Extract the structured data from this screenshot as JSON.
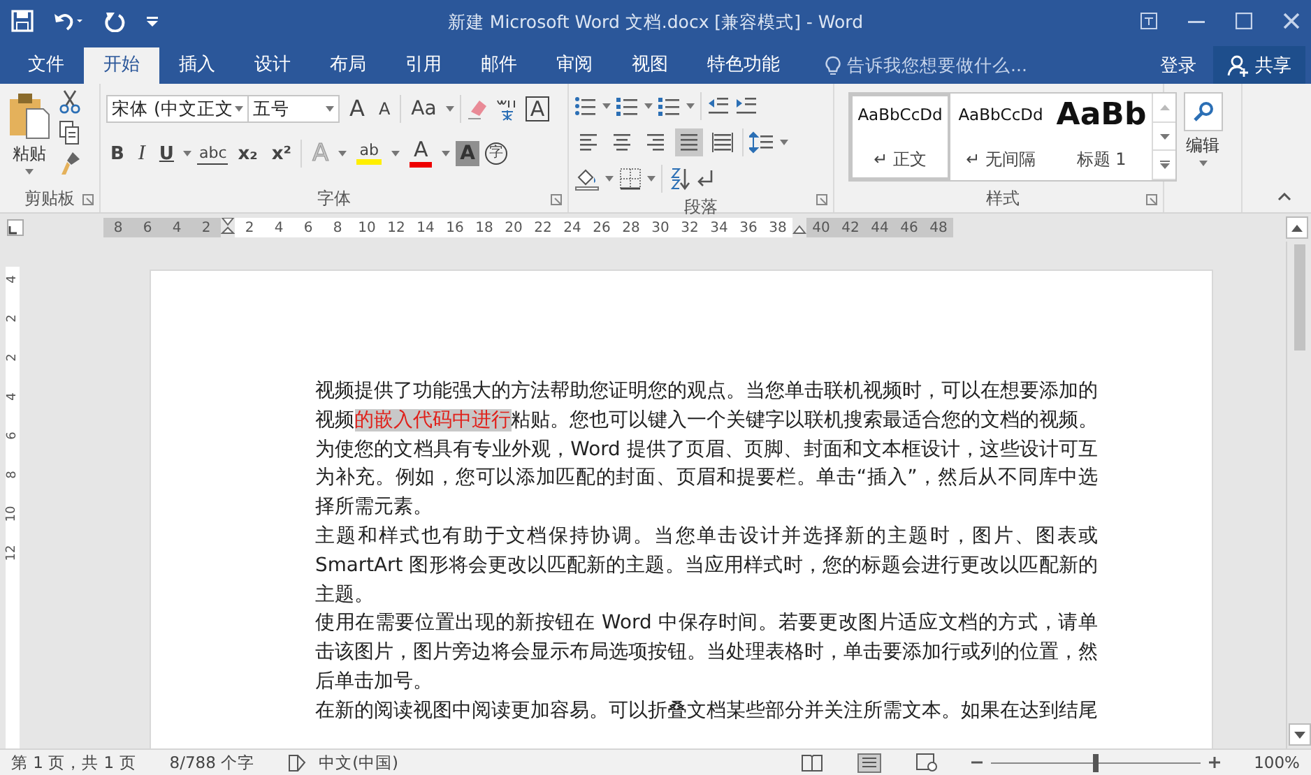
{
  "window": {
    "title": "新建 Microsoft Word 文档.docx [兼容模式] - Word"
  },
  "tabs": [
    {
      "label": "文件",
      "selected": false
    },
    {
      "label": "开始",
      "selected": true
    },
    {
      "label": "插入",
      "selected": false
    },
    {
      "label": "设计",
      "selected": false
    },
    {
      "label": "布局",
      "selected": false
    },
    {
      "label": "引用",
      "selected": false
    },
    {
      "label": "邮件",
      "selected": false
    },
    {
      "label": "审阅",
      "selected": false
    },
    {
      "label": "视图",
      "selected": false
    },
    {
      "label": "特色功能",
      "selected": false
    }
  ],
  "tell_me": {
    "placeholder": "告诉我您想要做什么..."
  },
  "account": {
    "sign_in": "登录",
    "share": "共享"
  },
  "ribbon": {
    "clipboard": {
      "paste": "粘贴",
      "label": "剪贴板"
    },
    "font": {
      "font_name": "宋体 (中文正文",
      "font_size": "五号",
      "label": "字体",
      "row1": [
        {
          "kind": "grow",
          "text": "A"
        },
        {
          "kind": "shrink",
          "text": "A"
        },
        {
          "kind": "case",
          "text": "Aa"
        },
        {
          "kind": "border",
          "text": "A"
        }
      ],
      "row2": [
        {
          "kind": "bold",
          "text": "B"
        },
        {
          "kind": "italic",
          "text": "I"
        },
        {
          "kind": "underline",
          "text": "U"
        },
        {
          "kind": "strike",
          "text": "abc"
        },
        {
          "kind": "sub",
          "text": "x₂"
        },
        {
          "kind": "sup",
          "text": "x²"
        },
        {
          "kind": "effects",
          "text": "A"
        },
        {
          "kind": "highlight",
          "text": "ab"
        },
        {
          "kind": "color",
          "text": "A"
        },
        {
          "kind": "shading",
          "text": "A"
        },
        {
          "kind": "enclose",
          "text": "字"
        }
      ]
    },
    "paragraph": {
      "label": "段落",
      "alignments": [
        {
          "kind": "left",
          "selected": false
        },
        {
          "kind": "center",
          "selected": false
        },
        {
          "kind": "right",
          "selected": false
        },
        {
          "kind": "justify",
          "selected": true
        },
        {
          "kind": "distributed",
          "selected": false
        }
      ]
    },
    "styles": {
      "label": "样式",
      "items": [
        {
          "kind": "normal",
          "preview": "AaBbCcDd",
          "name": "↵ 正文",
          "selected": true
        },
        {
          "kind": "normal",
          "preview": "AaBbCcDd",
          "name": "↵ 无间隔",
          "selected": false
        },
        {
          "kind": "heading",
          "preview": "AaBb",
          "name": "标题 1",
          "selected": false
        }
      ]
    },
    "editing": {
      "label": "编辑"
    }
  },
  "ruler": {
    "left_ticks": [
      "8",
      "6",
      "4",
      "2"
    ],
    "body_ticks": [
      "2",
      "4",
      "6",
      "8",
      "10",
      "12",
      "14",
      "16",
      "18",
      "20",
      "22",
      "24",
      "26",
      "28",
      "30",
      "32",
      "34",
      "36",
      "38"
    ],
    "right_ticks": [
      "40",
      "42",
      "44",
      "46",
      "48"
    ],
    "vertical_ticks": [
      "4",
      "2",
      "2",
      "4",
      "6",
      "8",
      "10",
      "12"
    ]
  },
  "document": {
    "paragraphs": [
      {
        "runs": [
          {
            "text": "视频提供了功能强大的方法帮助您证明您的观点。当您单击联机视频时，可以在想要添加的视频",
            "highlighted": false
          },
          {
            "text": "的嵌入代码中进行",
            "highlighted": true
          },
          {
            "text": "粘贴。您也可以键入一个关键字以联机搜索最适合您的文档的视频。",
            "highlighted": false
          }
        ]
      },
      {
        "runs": [
          {
            "text": "为使您的文档具有专业外观，Word 提供了页眉、页脚、封面和文本框设计，这些设计可互为补充。例如，您可以添加匹配的封面、页眉和提要栏。单击“插入”，然后从不同库中选择所需元素。",
            "highlighted": false
          }
        ]
      },
      {
        "runs": [
          {
            "text": "主题和样式也有助于文档保持协调。当您单击设计并选择新的主题时，图片、图表或 SmartArt 图形将会更改以匹配新的主题。当应用样式时，您的标题会进行更改以匹配新的主题。",
            "highlighted": false
          }
        ]
      },
      {
        "runs": [
          {
            "text": "使用在需要位置出现的新按钮在 Word 中保存时间。若要更改图片适应文档的方式，请单击该图片，图片旁边将会显示布局选项按钮。当处理表格时，单击要添加行或列的位置，然后单击加号。",
            "highlighted": false
          }
        ]
      },
      {
        "runs": [
          {
            "text": "在新的阅读视图中阅读更加容易。可以折叠文档某些部分并关注所需文本。如果在达到结尾",
            "highlighted": false
          }
        ]
      }
    ]
  },
  "status_bar": {
    "page": "第 1 页，共 1 页",
    "words": "8/788 个字",
    "language": "中文(中国)",
    "zoom_slider": {
      "level": 0.5
    },
    "zoom": "100%"
  }
}
